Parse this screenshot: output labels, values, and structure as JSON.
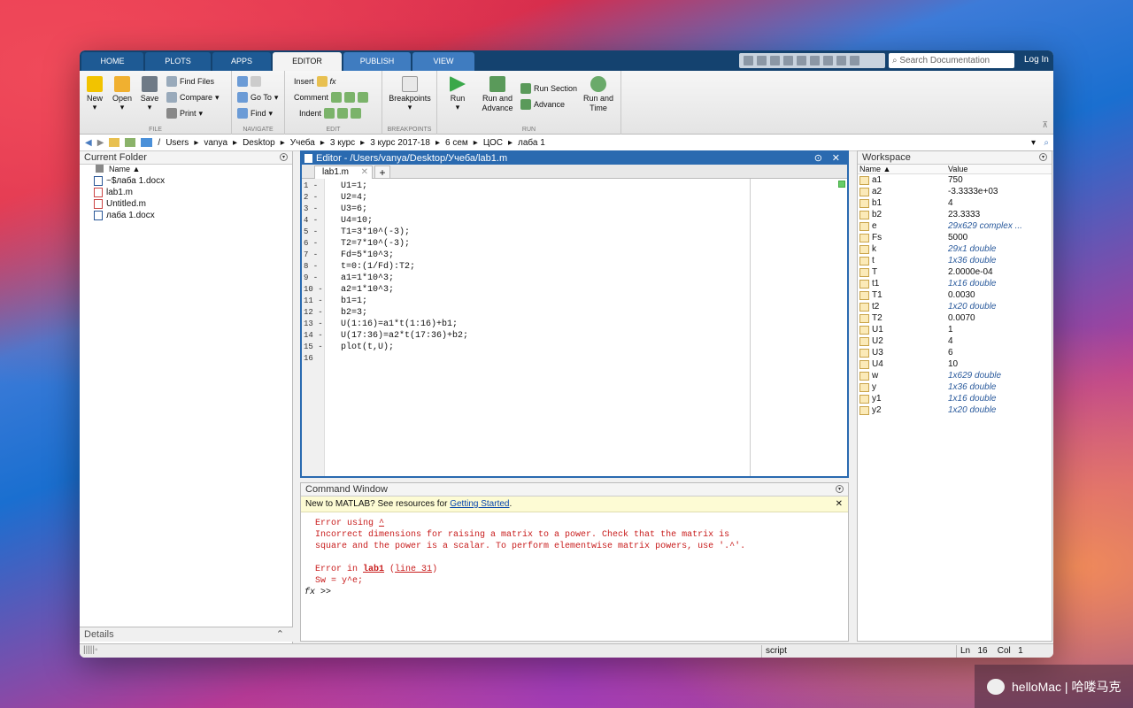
{
  "tabs": [
    "HOME",
    "PLOTS",
    "APPS",
    "EDITOR",
    "PUBLISH",
    "VIEW"
  ],
  "search_placeholder": "Search Documentation",
  "login_label": "Log In",
  "toolstrip": {
    "file": {
      "label": "FILE",
      "new": "New",
      "open": "Open",
      "save": "Save",
      "find_files": "Find Files",
      "compare": "Compare",
      "print": "Print"
    },
    "navigate": {
      "label": "NAVIGATE",
      "goto": "Go To",
      "find": "Find"
    },
    "edit": {
      "label": "EDIT",
      "insert": "Insert",
      "comment": "Comment",
      "indent": "Indent"
    },
    "breakpoints": {
      "label": "BREAKPOINTS",
      "button": "Breakpoints"
    },
    "run": {
      "label": "RUN",
      "run": "Run",
      "run_advance": "Run and Advance",
      "run_section": "Run Section",
      "advance": "Advance",
      "run_time": "Run and Time"
    }
  },
  "address": [
    "/",
    "Users",
    "vanya",
    "Desktop",
    "Учеба",
    "3 курс",
    "3 курс 2017-18",
    "6 сем",
    "ЦОС",
    "лаба 1"
  ],
  "current_folder": {
    "title": "Current Folder",
    "col_name": "Name ▲",
    "files": [
      "~$лаба 1.docx",
      "lab1.m",
      "Untitled.m",
      "лаба 1.docx"
    ]
  },
  "details_label": "Details",
  "editor": {
    "title": "Editor - /Users/vanya/Desktop/Учеба/lab1.m",
    "tab": "lab1.m",
    "lines": [
      "U1=1;",
      "U2=4;",
      "U3=6;",
      "U4=10;",
      "T1=3*10^(-3);",
      "T2=7*10^(-3);",
      "Fd=5*10^3;",
      "t=0:(1/Fd):T2;",
      "a1=1*10^3;",
      "a2=1*10^3;",
      "b1=1;",
      "b2=3;",
      "U(1:16)=a1*t(1:16)+b1;",
      "U(17:36)=a2*t(17:36)+b2;",
      "plot(t,U);",
      ""
    ]
  },
  "command_window": {
    "title": "Command Window",
    "banner_text": "New to MATLAB? See resources for ",
    "banner_link": "Getting Started",
    "banner_end": ".",
    "err1_a": "Error using ",
    "err1_b": "^",
    "err2": "Incorrect dimensions for raising a matrix to a power. Check that the matrix is",
    "err3": "square and the power is a scalar. To perform elementwise matrix powers, use '.^'.",
    "err4_a": "Error in ",
    "err4_b": "lab1",
    "err4_c": " (",
    "err4_d": "line 31",
    "err4_e": ")",
    "err5": "Sw = y^e;",
    "prompt": ">>"
  },
  "workspace": {
    "title": "Workspace",
    "col_name": "Name ▲",
    "col_value": "Value",
    "rows": [
      {
        "n": "a1",
        "v": "750",
        "it": false
      },
      {
        "n": "a2",
        "v": "-3.3333e+03",
        "it": false
      },
      {
        "n": "b1",
        "v": "4",
        "it": false
      },
      {
        "n": "b2",
        "v": "23.3333",
        "it": false
      },
      {
        "n": "e",
        "v": "29x629 complex ...",
        "it": true
      },
      {
        "n": "Fs",
        "v": "5000",
        "it": false
      },
      {
        "n": "k",
        "v": "29x1 double",
        "it": true
      },
      {
        "n": "t",
        "v": "1x36 double",
        "it": true
      },
      {
        "n": "T",
        "v": "2.0000e-04",
        "it": false
      },
      {
        "n": "t1",
        "v": "1x16 double",
        "it": true
      },
      {
        "n": "T1",
        "v": "0.0030",
        "it": false
      },
      {
        "n": "t2",
        "v": "1x20 double",
        "it": true
      },
      {
        "n": "T2",
        "v": "0.0070",
        "it": false
      },
      {
        "n": "U1",
        "v": "1",
        "it": false
      },
      {
        "n": "U2",
        "v": "4",
        "it": false
      },
      {
        "n": "U3",
        "v": "6",
        "it": false
      },
      {
        "n": "U4",
        "v": "10",
        "it": false
      },
      {
        "n": "w",
        "v": "1x629 double",
        "it": true
      },
      {
        "n": "y",
        "v": "1x36 double",
        "it": true
      },
      {
        "n": "y1",
        "v": "1x16 double",
        "it": true
      },
      {
        "n": "y2",
        "v": "1x20 double",
        "it": true
      }
    ]
  },
  "status": {
    "mode": "script",
    "ln_label": "Ln",
    "ln": "16",
    "col_label": "Col",
    "col": "1"
  },
  "watermark": "helloMac | 哈喽马克"
}
